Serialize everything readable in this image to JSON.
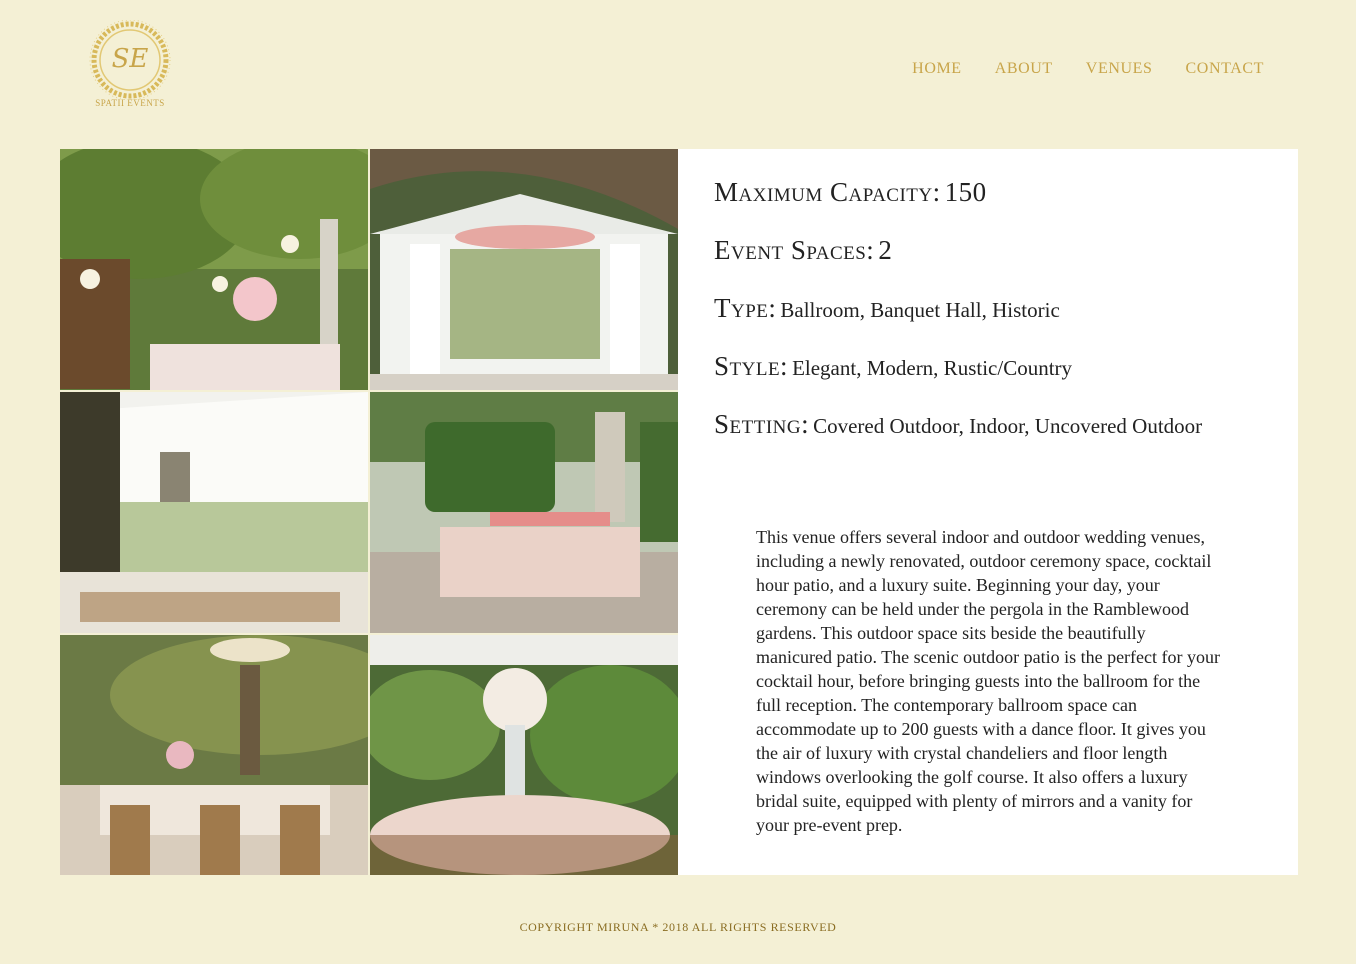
{
  "brand": {
    "monogram": "SE",
    "name": "SPATII EVENTS"
  },
  "nav": {
    "items": [
      "HOME",
      "ABOUT",
      "VENUES",
      "CONTACT"
    ]
  },
  "gallery": {
    "photos": [
      "garden-chandelier-reception",
      "white-gazebo-ceremony",
      "white-tent-reception",
      "statue-garden-dinner",
      "chandelier-banquet-tables",
      "floral-centerpiece-tent"
    ]
  },
  "details": {
    "capacity_label": "Maximum Capacity:",
    "capacity_value": "150",
    "spaces_label": "Event Spaces:",
    "spaces_value": "2",
    "type_label": "Type:",
    "type_value": "Ballroom, Banquet Hall, Historic",
    "style_label": "Style:",
    "style_value": "Elegant, Modern, Rustic/Country",
    "setting_label": "Setting:",
    "setting_value": "Covered Outdoor, Indoor, Uncovered Outdoor",
    "description": "This venue offers several indoor and outdoor wedding venues, including a newly renovated, outdoor ceremony space, cocktail hour patio, and a luxury suite. Beginning your day, your ceremony can be held under the pergola in the Ramblewood gardens. This outdoor space sits beside the beautifully manicured patio. The scenic outdoor patio is the perfect for your cocktail hour, before bringing guests into the ballroom for the full reception. The contemporary ballroom space can accommodate up to 200 guests with a dance floor. It gives you the air of luxury with crystal chandeliers and floor length windows overlooking the golf course. It also offers a luxury bridal suite, equipped with plenty of mirrors and a vanity for your pre-event prep."
  },
  "footer": {
    "copyright": "COPYRIGHT MIRUNA * 2018 ALL RIGHTS RESERVED"
  },
  "colors": {
    "background": "#f4f0d5",
    "gold": "#c8a54a",
    "panel": "#ffffff",
    "text": "#222222"
  }
}
